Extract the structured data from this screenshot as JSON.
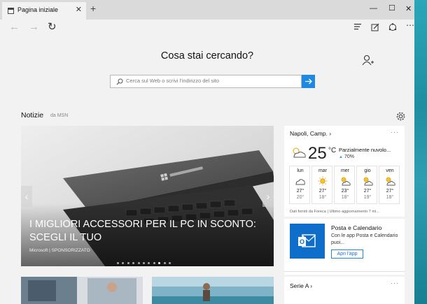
{
  "tab": {
    "title": "Pagina iniziale"
  },
  "search": {
    "question": "Cosa stai cercando?",
    "placeholder": "Cerca sul Web o scrivi l'indirizzo del sito"
  },
  "news": {
    "title": "Notizie",
    "source": "da MSN",
    "hero": {
      "headline": "I MIGLIORI ACCESSORI PER IL PC IN SCONTO: SCEGLI IL TUO",
      "meta": "Microsoft | SPONSORIZZATO",
      "dots_total": 11,
      "active_dot": 9
    }
  },
  "weather": {
    "location": "Napoli, Camp. ›",
    "more": "···",
    "temp": "25",
    "unit": "°C",
    "condition": "Parzialmente nuvolo...",
    "humidity": "70%",
    "forecast": [
      {
        "day": "lun",
        "icon": "cloud-icon",
        "hi": "27°",
        "lo": "20°"
      },
      {
        "day": "mar",
        "icon": "sun-icon",
        "hi": "27°",
        "lo": "18°"
      },
      {
        "day": "mer",
        "icon": "partly-sunny-icon",
        "hi": "23°",
        "lo": "18°"
      },
      {
        "day": "gio",
        "icon": "partly-sunny-icon",
        "hi": "27°",
        "lo": "19°"
      },
      {
        "day": "ven",
        "icon": "partly-sunny-icon",
        "hi": "27°",
        "lo": "18°"
      }
    ],
    "footer": "Dati forniti da Foreca | Ultimo aggiornamento 7 mi..."
  },
  "mail": {
    "title": "Posta e Calendario",
    "desc": "Con le app Posta e Calendario puoi...",
    "button": "Apri l'app"
  },
  "sports": {
    "title": "Serie A ›",
    "more": "···"
  },
  "colors": {
    "accent": "#1e88e5",
    "mail_logo": "#0f6ec9"
  }
}
